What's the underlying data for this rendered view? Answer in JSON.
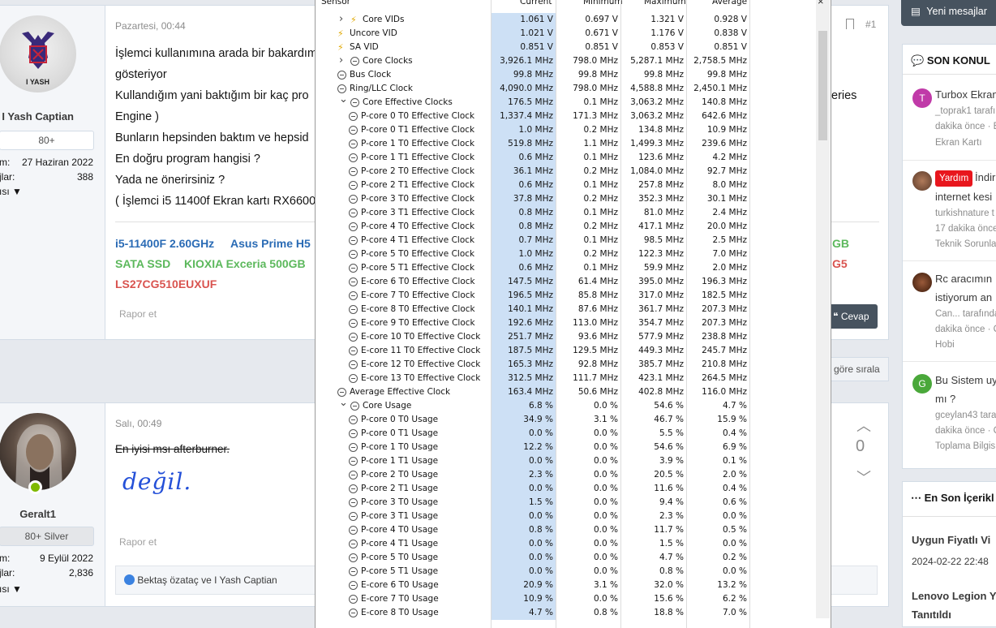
{
  "forum": {
    "post1": {
      "date": "Pazartesi, 00:44",
      "username": "I Yash Captian",
      "avatar_text": "I YASH",
      "badge": "80+",
      "meta1_label": "m:",
      "meta1_value": "27 Haziran 2022",
      "meta2_label": "jlar:",
      "meta2_value": "388",
      "meta3_label": "ısı",
      "post_id": "#1",
      "lines": [
        "İşlemci kullanımına arada bir bakardım",
        "gösteriyor",
        "Kullandığım yani baktığım bir kaç pro",
        "Engine )",
        "Bunların hepsinden baktım ve hepsid",
        "En doğru program hangisi ?",
        "Yada ne önerirsiniz ?",
        "( İşlemci i5 11400f Ekran kartı RX6600"
      ],
      "right_text": "eries",
      "sig1a": "i5-11400F 2.60GHz",
      "sig1b": "Asus Prime H5",
      "sig2a": "SATA SSD",
      "sig2b": "KIOXIA Exceria 500GB",
      "sig3": "LS27CG510EUXUF",
      "sig_right1": "GB",
      "sig_right2": "G5",
      "report": "Rapor et",
      "reply": "Cevap"
    },
    "sort_text": "göre sırala",
    "post2": {
      "date": "Salı, 00:49",
      "username": "Geralt1",
      "badge": "80+ Silver",
      "meta1_label": "m:",
      "meta1_value": "9 Eylül 2022",
      "meta2_label": "jlar:",
      "meta2_value": "2,836",
      "meta3_label": "ısı",
      "struck_text": "En iyisi msı afterburner.",
      "handwriting": "değil.",
      "vote_count": "0",
      "report": "Rapor et",
      "reactions": "Bektaş özataç",
      "reactions_and": "ve",
      "reactions_name2": "I Yash Captian"
    },
    "sidebar": {
      "new_messages": "Yeni mesajlar",
      "recent_title": "SON KONUL",
      "threads": [
        {
          "avatar": "T",
          "avatar_color": "#c03aa8",
          "title": "Turbox Ekran",
          "line2": "_toprak1 tarafı",
          "line3": "dakika önce · E",
          "line4": "Ekran Kartı"
        },
        {
          "tag": "Yardım",
          "title": "İndir",
          "line2": "internet kesi",
          "line3": "turkishnature t",
          "line4": "17 dakika önce",
          "line5": "Teknik Sorunla"
        },
        {
          "title": "Rc aracımın",
          "line2": "istiyorum an",
          "line3": "Can... tarafında",
          "line4": "dakika önce · C",
          "line5": "Hobi"
        },
        {
          "avatar": "G",
          "avatar_color": "#4aa83a",
          "title": "Bu Sistem uy",
          "line2": "mı ?",
          "line3": "gceylan43 tara",
          "line4": "dakika önce · C",
          "line5": "Toplama Bilgis"
        }
      ],
      "latest_title": "En Son İçerikl",
      "latest": [
        {
          "title": "Uygun Fiyatlı Vi",
          "date": "2024-02-22 22:48"
        },
        {
          "title": "Lenovo Legion Y",
          "line2": "Tanıtıldı"
        }
      ]
    }
  },
  "hwinfo": {
    "headers": {
      "sensor": "Sensor",
      "current": "Current",
      "minimum": "Minimum",
      "maximum": "Maximum",
      "average": "Average"
    },
    "rows": [
      {
        "icon": "bolt",
        "expand": ">",
        "indent": 1,
        "name": "Core VIDs",
        "cur": "1.061 V",
        "min": "0.697 V",
        "max": "1.321 V",
        "avg": "0.928 V"
      },
      {
        "icon": "bolt",
        "indent": 0,
        "name": "Uncore VID",
        "cur": "1.021 V",
        "min": "0.671 V",
        "max": "1.176 V",
        "avg": "0.838 V"
      },
      {
        "icon": "bolt",
        "indent": 0,
        "name": "SA VID",
        "cur": "0.851 V",
        "min": "0.851 V",
        "max": "0.853 V",
        "avg": "0.851 V"
      },
      {
        "icon": "clock",
        "expand": ">",
        "indent": 1,
        "name": "Core Clocks",
        "cur": "3,926.1 MHz",
        "min": "798.0 MHz",
        "max": "5,287.1 MHz",
        "avg": "2,758.5 MHz"
      },
      {
        "icon": "clock",
        "indent": 0,
        "name": "Bus Clock",
        "cur": "99.8 MHz",
        "min": "99.8 MHz",
        "max": "99.8 MHz",
        "avg": "99.8 MHz"
      },
      {
        "icon": "clock",
        "indent": 0,
        "name": "Ring/LLC Clock",
        "cur": "4,090.0 MHz",
        "min": "798.0 MHz",
        "max": "4,588.8 MHz",
        "avg": "2,450.1 MHz"
      },
      {
        "icon": "clock",
        "expand": "v",
        "indent": 1,
        "name": "Core Effective Clocks",
        "cur": "176.5 MHz",
        "min": "0.1 MHz",
        "max": "3,063.2 MHz",
        "avg": "140.8 MHz"
      },
      {
        "icon": "clock",
        "indent": 2,
        "name": "P-core 0 T0 Effective Clock",
        "cur": "1,337.4 MHz",
        "min": "171.3 MHz",
        "max": "3,063.2 MHz",
        "avg": "642.6 MHz"
      },
      {
        "icon": "clock",
        "indent": 2,
        "name": "P-core 0 T1 Effective Clock",
        "cur": "1.0 MHz",
        "min": "0.2 MHz",
        "max": "134.8 MHz",
        "avg": "10.9 MHz"
      },
      {
        "icon": "clock",
        "indent": 2,
        "name": "P-core 1 T0 Effective Clock",
        "cur": "519.8 MHz",
        "min": "1.1 MHz",
        "max": "1,499.3 MHz",
        "avg": "239.6 MHz"
      },
      {
        "icon": "clock",
        "indent": 2,
        "name": "P-core 1 T1 Effective Clock",
        "cur": "0.6 MHz",
        "min": "0.1 MHz",
        "max": "123.6 MHz",
        "avg": "4.2 MHz"
      },
      {
        "icon": "clock",
        "indent": 2,
        "name": "P-core 2 T0 Effective Clock",
        "cur": "36.1 MHz",
        "min": "0.2 MHz",
        "max": "1,084.0 MHz",
        "avg": "92.7 MHz"
      },
      {
        "icon": "clock",
        "indent": 2,
        "name": "P-core 2 T1 Effective Clock",
        "cur": "0.6 MHz",
        "min": "0.1 MHz",
        "max": "257.8 MHz",
        "avg": "8.0 MHz"
      },
      {
        "icon": "clock",
        "indent": 2,
        "name": "P-core 3 T0 Effective Clock",
        "cur": "37.8 MHz",
        "min": "0.2 MHz",
        "max": "352.3 MHz",
        "avg": "30.1 MHz"
      },
      {
        "icon": "clock",
        "indent": 2,
        "name": "P-core 3 T1 Effective Clock",
        "cur": "0.8 MHz",
        "min": "0.1 MHz",
        "max": "81.0 MHz",
        "avg": "2.4 MHz"
      },
      {
        "icon": "clock",
        "indent": 2,
        "name": "P-core 4 T0 Effective Clock",
        "cur": "0.8 MHz",
        "min": "0.2 MHz",
        "max": "417.1 MHz",
        "avg": "20.0 MHz"
      },
      {
        "icon": "clock",
        "indent": 2,
        "name": "P-core 4 T1 Effective Clock",
        "cur": "0.7 MHz",
        "min": "0.1 MHz",
        "max": "98.5 MHz",
        "avg": "2.5 MHz"
      },
      {
        "icon": "clock",
        "indent": 2,
        "name": "P-core 5 T0 Effective Clock",
        "cur": "1.0 MHz",
        "min": "0.2 MHz",
        "max": "122.3 MHz",
        "avg": "7.0 MHz"
      },
      {
        "icon": "clock",
        "indent": 2,
        "name": "P-core 5 T1 Effective Clock",
        "cur": "0.6 MHz",
        "min": "0.1 MHz",
        "max": "59.9 MHz",
        "avg": "2.0 MHz"
      },
      {
        "icon": "clock",
        "indent": 2,
        "name": "E-core 6 T0 Effective Clock",
        "cur": "147.5 MHz",
        "min": "61.4 MHz",
        "max": "395.0 MHz",
        "avg": "196.3 MHz"
      },
      {
        "icon": "clock",
        "indent": 2,
        "name": "E-core 7 T0 Effective Clock",
        "cur": "196.5 MHz",
        "min": "85.8 MHz",
        "max": "317.0 MHz",
        "avg": "182.5 MHz"
      },
      {
        "icon": "clock",
        "indent": 2,
        "name": "E-core 8 T0 Effective Clock",
        "cur": "140.1 MHz",
        "min": "87.6 MHz",
        "max": "361.7 MHz",
        "avg": "207.3 MHz"
      },
      {
        "icon": "clock",
        "indent": 2,
        "name": "E-core 9 T0 Effective Clock",
        "cur": "192.6 MHz",
        "min": "113.0 MHz",
        "max": "354.7 MHz",
        "avg": "207.3 MHz"
      },
      {
        "icon": "clock",
        "indent": 2,
        "name": "E-core 10 T0 Effective Clock",
        "cur": "251.7 MHz",
        "min": "93.6 MHz",
        "max": "577.9 MHz",
        "avg": "238.8 MHz"
      },
      {
        "icon": "clock",
        "indent": 2,
        "name": "E-core 11 T0 Effective Clock",
        "cur": "187.5 MHz",
        "min": "129.5 MHz",
        "max": "449.3 MHz",
        "avg": "245.7 MHz"
      },
      {
        "icon": "clock",
        "indent": 2,
        "name": "E-core 12 T0 Effective Clock",
        "cur": "165.3 MHz",
        "min": "92.8 MHz",
        "max": "385.7 MHz",
        "avg": "210.8 MHz"
      },
      {
        "icon": "clock",
        "indent": 2,
        "name": "E-core 13 T0 Effective Clock",
        "cur": "312.5 MHz",
        "min": "111.7 MHz",
        "max": "423.1 MHz",
        "avg": "264.5 MHz"
      },
      {
        "icon": "clock",
        "indent": 0,
        "name": "Average Effective Clock",
        "cur": "163.4 MHz",
        "min": "50.6 MHz",
        "max": "402.8 MHz",
        "avg": "116.0 MHz"
      },
      {
        "icon": "clock",
        "expand": "v",
        "indent": 1,
        "name": "Core Usage",
        "cur": "6.8 %",
        "min": "0.0 %",
        "max": "54.6 %",
        "avg": "4.7 %"
      },
      {
        "icon": "clock",
        "indent": 2,
        "name": "P-core 0 T0 Usage",
        "cur": "34.9 %",
        "min": "3.1 %",
        "max": "46.7 %",
        "avg": "15.9 %"
      },
      {
        "icon": "clock",
        "indent": 2,
        "name": "P-core 0 T1 Usage",
        "cur": "0.0 %",
        "min": "0.0 %",
        "max": "5.5 %",
        "avg": "0.4 %"
      },
      {
        "icon": "clock",
        "indent": 2,
        "name": "P-core 1 T0 Usage",
        "cur": "12.2 %",
        "min": "0.0 %",
        "max": "54.6 %",
        "avg": "6.9 %"
      },
      {
        "icon": "clock",
        "indent": 2,
        "name": "P-core 1 T1 Usage",
        "cur": "0.0 %",
        "min": "0.0 %",
        "max": "3.9 %",
        "avg": "0.1 %"
      },
      {
        "icon": "clock",
        "indent": 2,
        "name": "P-core 2 T0 Usage",
        "cur": "2.3 %",
        "min": "0.0 %",
        "max": "20.5 %",
        "avg": "2.0 %"
      },
      {
        "icon": "clock",
        "indent": 2,
        "name": "P-core 2 T1 Usage",
        "cur": "0.0 %",
        "min": "0.0 %",
        "max": "11.6 %",
        "avg": "0.4 %"
      },
      {
        "icon": "clock",
        "indent": 2,
        "name": "P-core 3 T0 Usage",
        "cur": "1.5 %",
        "min": "0.0 %",
        "max": "9.4 %",
        "avg": "0.6 %"
      },
      {
        "icon": "clock",
        "indent": 2,
        "name": "P-core 3 T1 Usage",
        "cur": "0.0 %",
        "min": "0.0 %",
        "max": "2.3 %",
        "avg": "0.0 %"
      },
      {
        "icon": "clock",
        "indent": 2,
        "name": "P-core 4 T0 Usage",
        "cur": "0.8 %",
        "min": "0.0 %",
        "max": "11.7 %",
        "avg": "0.5 %"
      },
      {
        "icon": "clock",
        "indent": 2,
        "name": "P-core 4 T1 Usage",
        "cur": "0.0 %",
        "min": "0.0 %",
        "max": "1.5 %",
        "avg": "0.0 %"
      },
      {
        "icon": "clock",
        "indent": 2,
        "name": "P-core 5 T0 Usage",
        "cur": "0.0 %",
        "min": "0.0 %",
        "max": "4.7 %",
        "avg": "0.2 %"
      },
      {
        "icon": "clock",
        "indent": 2,
        "name": "P-core 5 T1 Usage",
        "cur": "0.0 %",
        "min": "0.0 %",
        "max": "0.8 %",
        "avg": "0.0 %"
      },
      {
        "icon": "clock",
        "indent": 2,
        "name": "E-core 6 T0 Usage",
        "cur": "20.9 %",
        "min": "3.1 %",
        "max": "32.0 %",
        "avg": "13.2 %"
      },
      {
        "icon": "clock",
        "indent": 2,
        "name": "E-core 7 T0 Usage",
        "cur": "10.9 %",
        "min": "0.0 %",
        "max": "15.6 %",
        "avg": "6.2 %"
      },
      {
        "icon": "clock",
        "indent": 2,
        "name": "E-core 8 T0 Usage",
        "cur": "4.7 %",
        "min": "0.8 %",
        "max": "18.8 %",
        "avg": "7.0 %"
      }
    ]
  },
  "colors": {
    "sig_blue": "#2a6bb5",
    "sig_green": "#5cb85c",
    "sig_red": "#d9534f",
    "cell_highlight": "#cde0f5",
    "yardim_tag": "#e8161d"
  }
}
